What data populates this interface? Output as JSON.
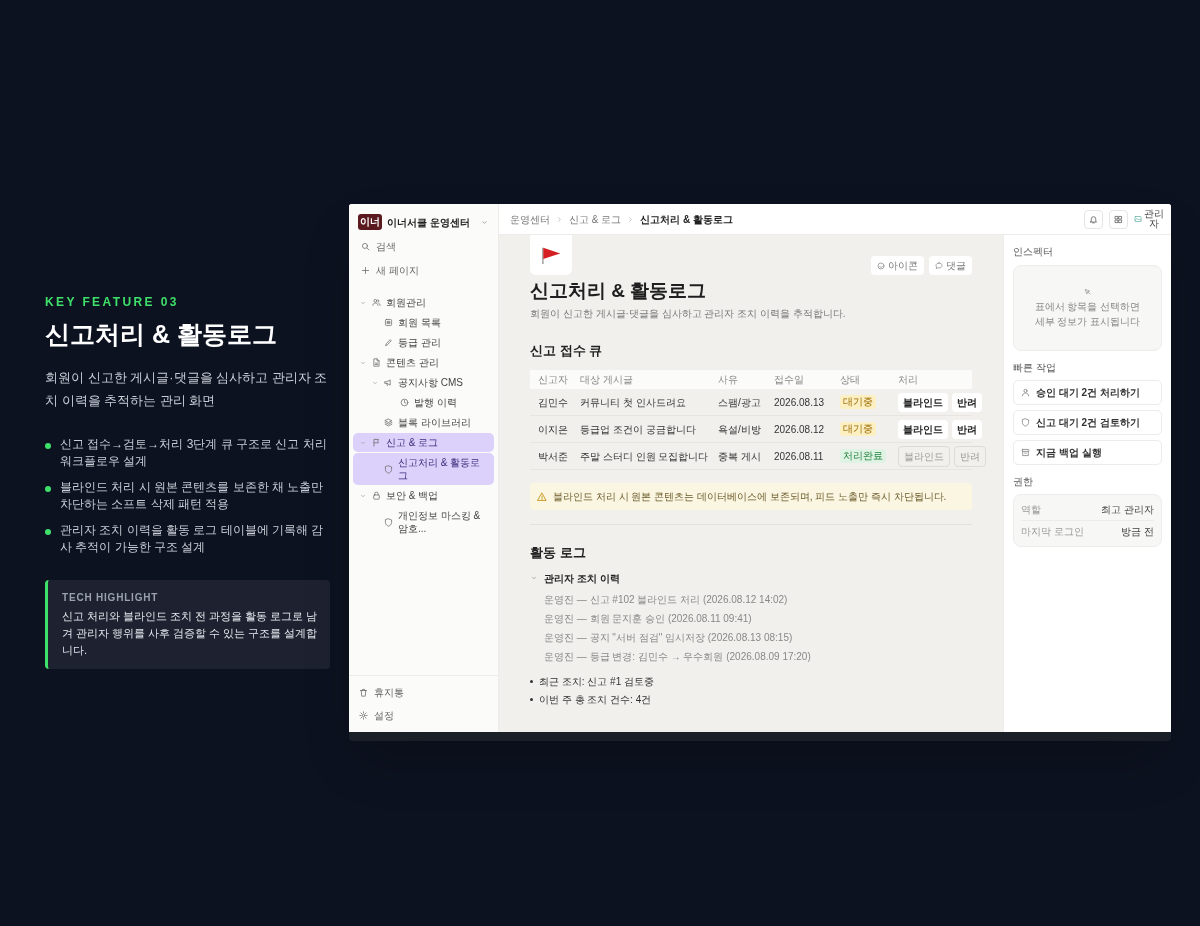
{
  "feature": {
    "eyebrow": "KEY FEATURE 03",
    "title": "신고처리 & 활동로그",
    "description": "회원이 신고한 게시글·댓글을 심사하고 관리자 조치 이력을 추적하는 관리 화면",
    "bullets": [
      "신고 접수→검토→처리 3단계 큐 구조로 신고 처리 워크플로우 설계",
      "블라인드 처리 시 원본 콘텐츠를 보존한 채 노출만 차단하는 소프트 삭제 패턴 적용",
      "관리자 조치 이력을 활동 로그 테이블에 기록해 감사 추적이 가능한 구조 설계"
    ],
    "highlight": {
      "label": "TECH HIGHLIGHT",
      "text": "신고 처리와 블라인드 조치 전 과정을 활동 로그로 남겨 관리자 행위를 사후 검증할 수 있는 구조를 설계합니다."
    }
  },
  "app": {
    "sidebar": {
      "workspace": {
        "logo": "이너",
        "name": "이너서클 운영센터"
      },
      "search": "검색",
      "new_page": "새 페이지",
      "tree": [
        {
          "label": "회원관리",
          "expanded": true,
          "selected": false,
          "children": [
            {
              "label": "회원 목록",
              "selected": false
            },
            {
              "label": "등급 관리",
              "selected": false
            }
          ]
        },
        {
          "label": "콘텐츠 관리",
          "expanded": true,
          "selected": false,
          "children": [
            {
              "label": "공지사항 CMS",
              "expanded": true,
              "selected": false,
              "children": [
                {
                  "label": "발행 이력",
                  "selected": false
                }
              ]
            },
            {
              "label": "블록 라이브러리",
              "selected": false
            }
          ]
        },
        {
          "label": "신고 & 로그",
          "expanded": true,
          "selected": true,
          "children": [
            {
              "label": "신고처리 & 활동로그",
              "selected": true
            }
          ]
        },
        {
          "label": "보안 & 백업",
          "expanded": true,
          "selected": false,
          "children": [
            {
              "label": "개인정보 마스킹 & 암호...",
              "selected": false
            }
          ]
        }
      ],
      "footer": [
        "휴지통",
        "설정"
      ]
    },
    "breadcrumb": [
      "운영센터",
      "신고 & 로그",
      "신고처리 & 활동로그"
    ],
    "avatar": "관리자",
    "page": {
      "title": "신고처리 & 활동로그",
      "description": "회원이 신고한 게시글·댓글을 심사하고 관리자 조치 이력을 추적합니다.",
      "actions": [
        "아이콘",
        "댓글"
      ],
      "queue": {
        "heading": "신고 접수 큐",
        "columns": [
          "신고자",
          "대상 게시글",
          "사유",
          "접수일",
          "상태",
          "처리"
        ],
        "rows": [
          {
            "reporter": "김민수",
            "post": "커뮤니티 첫 인사드려요",
            "reason": "스팸/광고",
            "date": "2026.08.13",
            "status": {
              "label": "대기중",
              "kind": "pending"
            },
            "actions": [
              {
                "label": "블라인드",
                "disabled": false
              },
              {
                "label": "반려",
                "disabled": false
              }
            ]
          },
          {
            "reporter": "이지은",
            "post": "등급업 조건이 궁금합니다",
            "reason": "욕설/비방",
            "date": "2026.08.12",
            "status": {
              "label": "대기중",
              "kind": "pending"
            },
            "actions": [
              {
                "label": "블라인드",
                "disabled": false
              },
              {
                "label": "반려",
                "disabled": false
              }
            ]
          },
          {
            "reporter": "박서준",
            "post": "주말 스터디 인원 모집합니다",
            "reason": "중복 게시",
            "date": "2026.08.11",
            "status": {
              "label": "처리완료",
              "kind": "done"
            },
            "actions": [
              {
                "label": "블라인드",
                "disabled": true
              },
              {
                "label": "반려",
                "disabled": true
              }
            ]
          }
        ]
      },
      "notice": "블라인드 처리 시 원본 콘텐츠는 데이터베이스에 보존되며, 피드 노출만 즉시 차단됩니다.",
      "log": {
        "heading": "활동 로그",
        "toggle": {
          "label": "관리자 조치 이력",
          "expanded": true
        },
        "entries": [
          "운영진 — 신고 #102 블라인드 처리 (2026.08.12 14:02)",
          "운영진 — 회원 문지훈 승인 (2026.08.11 09:41)",
          "운영진 — 공지 \"서버 점검\" 임시저장 (2026.08.13 08:15)",
          "운영진 — 등급 변경: 김민수 → 우수회원 (2026.08.09 17:20)"
        ],
        "bullets": [
          "최근 조치: 신고 #1 검토중",
          "이번 주 총 조치 건수: 4건"
        ]
      }
    },
    "inspector": {
      "heading": "인스펙터",
      "empty": "표에서 항목을 선택하면\n세부 정보가 표시됩니다"
    },
    "quick_actions": {
      "heading": "빠른 작업",
      "items": [
        "승인 대기 2건 처리하기",
        "신고 대기 2건 검토하기",
        "지금 백업 실행"
      ]
    },
    "permissions": {
      "heading": "권한",
      "rows": [
        {
          "label": "역할",
          "value": "최고 관리자"
        },
        {
          "label": "마지막 로그인",
          "value": "방금 전"
        }
      ]
    }
  }
}
